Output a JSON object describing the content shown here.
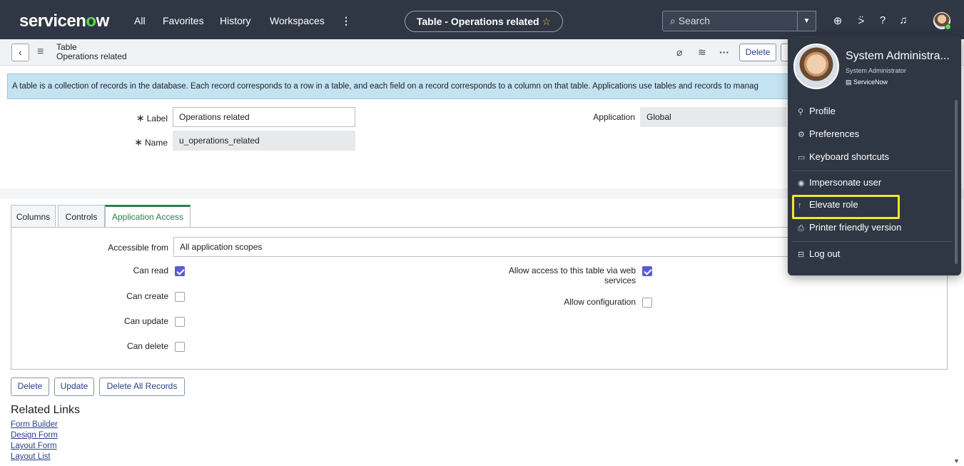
{
  "nav": {
    "logo_pre": "servicen",
    "logo_o": "o",
    "logo_post": "w",
    "links": [
      "All",
      "Favorites",
      "History",
      "Workspaces"
    ],
    "more": "⋮",
    "context_title": "Table - Operations related",
    "search_placeholder": "Search"
  },
  "form": {
    "title_line1": "Table",
    "title_line2": "Operations related",
    "delete_label": "Delete",
    "banner": "A table is a collection of records in the database. Each record corresponds to a row in a table, and each field on a record corresponds to a column on that table. Applications use tables and records to manag",
    "label_label": "Label",
    "label_value": "Operations related",
    "name_label": "Name",
    "name_value": "u_operations_related",
    "application_label": "Application",
    "application_value": "Global"
  },
  "tabs": [
    {
      "label": "Columns"
    },
    {
      "label": "Controls"
    },
    {
      "label": "Application Access",
      "active": true
    }
  ],
  "access": {
    "accessible_from_label": "Accessible from",
    "accessible_from_value": "All application scopes",
    "can_read": "Can read",
    "can_create": "Can create",
    "can_update": "Can update",
    "can_delete": "Can delete",
    "web_access_line1": "Allow access to this table via web",
    "web_access_line2": "services",
    "allow_config": "Allow configuration",
    "checked": {
      "can_read": true,
      "can_create": false,
      "can_update": false,
      "can_delete": false,
      "web_access": true,
      "allow_config": false
    }
  },
  "bottom_buttons": {
    "delete": "Delete",
    "update": "Update",
    "delete_all": "Delete All Records"
  },
  "related_links": {
    "title": "Related Links",
    "items": [
      "Form Builder",
      "Design Form",
      "Layout Form",
      "Layout List"
    ]
  },
  "user_menu": {
    "name": "System Administra...",
    "role": "System Administrator",
    "org": "ServiceNow",
    "items": {
      "profile": "Profile",
      "preferences": "Preferences",
      "keyboard": "Keyboard shortcuts",
      "impersonate": "Impersonate user",
      "elevate": "Elevate role",
      "printer": "Printer friendly version",
      "logout": "Log out"
    }
  },
  "colors": {
    "nav_bg": "#2f3644",
    "logo_accent": "#62d84e",
    "tab_active": "#2c7d4f",
    "checkbox_on": "#5b5bd6",
    "highlight": "#f2e52b",
    "banner_bg": "#c3e3f3"
  }
}
